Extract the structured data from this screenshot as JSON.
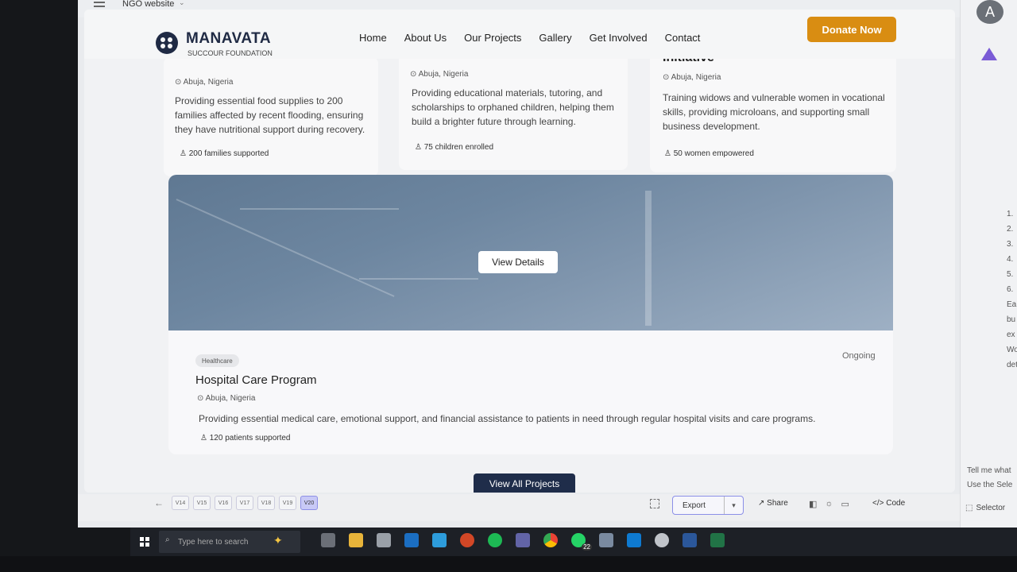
{
  "editor": {
    "doc_title": "NGO website",
    "avatar_letter": "A"
  },
  "site": {
    "brand": "MANAVATA",
    "brand_sub": "SUCCOUR FOUNDATION",
    "nav": [
      "Home",
      "About Us",
      "Our Projects",
      "Gallery",
      "Get Involved",
      "Contact"
    ],
    "donate_label": "Donate Now"
  },
  "cards": [
    {
      "location": "Abuja, Nigeria",
      "description": "Providing essential food supplies to 200 families affected by recent flooding, ensuring they have nutritional support during recovery.",
      "stat": "200 families supported"
    },
    {
      "location": "Abuja, Nigeria",
      "description": "Providing educational materials, tutoring, and scholarships to orphaned children, helping them build a brighter future through learning.",
      "stat": "75 children enrolled"
    },
    {
      "title": "Initiative",
      "location": "Abuja, Nigeria",
      "description": "Training widows and vulnerable women in vocational skills, providing microloans, and supporting small business development.",
      "stat": "50 women empowered"
    }
  ],
  "project": {
    "view_details": "View Details",
    "tag": "Healthcare",
    "status": "Ongoing",
    "title": "Hospital Care Program",
    "location": "Abuja, Nigeria",
    "description": "Providing essential medical care, emotional support, and financial assistance to patients in need through regular hospital visits and care programs.",
    "stat": "120 patients supported"
  },
  "view_all": "View All Projects",
  "toolbar": {
    "versions": [
      "V14",
      "V15",
      "V16",
      "V17",
      "V18",
      "V19",
      "V20"
    ],
    "active_version": "V20",
    "export": "Export",
    "share": "Share",
    "code": "Code"
  },
  "side_panel": {
    "list": [
      "1.",
      "2.",
      "3.",
      "4.",
      "5.",
      "6.",
      "Ea",
      "bu",
      "ex",
      "Wo",
      "det"
    ],
    "tell": "Tell me what",
    "use_sel": "Use the Sele",
    "selector": "Selector"
  },
  "taskbar": {
    "search_placeholder": "Type here to search",
    "badge": "22"
  }
}
